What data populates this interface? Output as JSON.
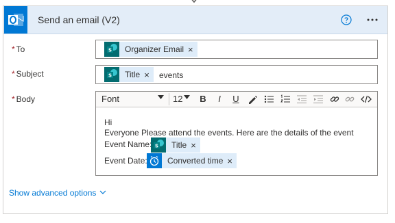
{
  "action": {
    "title": "Send an email (V2)"
  },
  "fields": {
    "to_label": "To",
    "subject_label": "Subject",
    "body_label": "Body",
    "required_mark": "*",
    "to_token": "Organizer Email",
    "subject_token": "Title",
    "subject_text": "events"
  },
  "toolbar": {
    "font": "Font",
    "size": "12",
    "bold": "B",
    "italic": "I",
    "underline": "U"
  },
  "body": {
    "line1": "Hi",
    "line2": "Everyone Please attend the events. Here are the details of the event",
    "event_name_label": "Event Name:",
    "event_name_token": "Title",
    "event_date_label": "Event Date:",
    "event_date_token": "Converted time"
  },
  "token_remove": "×",
  "advanced_options": "Show advanced options",
  "colors": {
    "header_bg": "#e3edf8",
    "outlook_blue": "#0078d4",
    "sharepoint_teal": "#036c70",
    "token_bg": "#deecf9",
    "required_red": "#a4262c",
    "link_blue": "#0078d4"
  }
}
